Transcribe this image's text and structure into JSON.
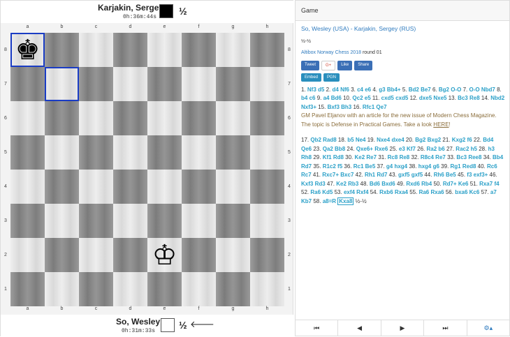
{
  "players": {
    "black": {
      "name": "Karjakin, Sergey",
      "clock": "0h:36m:44s",
      "result": "½"
    },
    "white": {
      "name": "So, Wesley",
      "clock": "0h:31m:33s",
      "result": "½",
      "to_move_arrow": "🡐"
    }
  },
  "board": {
    "files": [
      "a",
      "b",
      "c",
      "d",
      "e",
      "f",
      "g",
      "h"
    ],
    "ranks": [
      "8",
      "7",
      "6",
      "5",
      "4",
      "3",
      "2",
      "1"
    ],
    "pieces": [
      {
        "square": "a8",
        "piece": "black-king",
        "glyph": "♚"
      },
      {
        "square": "e2",
        "piece": "white-king",
        "glyph": "♔"
      }
    ],
    "highlighted": [
      "a8",
      "b7"
    ]
  },
  "panel": {
    "header": "Game",
    "title": "So, Wesley (USA) - Karjakin, Sergey (RUS)",
    "result": "½-½",
    "event_link": "Altibox Norway Chess 2018",
    "round": "round 01",
    "share": {
      "tweet": "Tweet",
      "gplus": "G+",
      "like": "Like",
      "share": "Share",
      "embed": "Embed",
      "pgn": "PGN"
    },
    "moves1": "1. Nf3 d5 2. d4 Nf6 3. c4 e6 4. g3 Bb4+ 5. Bd2 Be7 6. Bg2 O-O 7. O-O Nbd7 8. b4 c6 9. a4 Bd6 10. Qc2 e5 11. cxd5 cxd5 12. dxe5 Nxe5 13. Bc3 Re8 14. Nbd2 Nxf3+ 15. Bxf3 Bh3 16. Rfc1 Qe7",
    "comment_text": "GM Pavel Eljanov with an article for the new issue of Modern Chess Magazine. The topic is Defense in Practical Games. Take a look",
    "comment_link": "HERE",
    "comment_end": "!",
    "moves2": "17. Qb2 Rad8 18. b5 Ne4 19. Nxe4 dxe4 20. Bg2 Bxg2 21. Kxg2 f6 22. Bd4 Qe6 23. Qa2 Bb8 24. Qxe6+ Rxe6 25. e3 Kf7 26. Ra2 b6 27. Rac2 h5 28. h3 Rh8 29. Kf1 Rd8 30. Ke2 Re7 31. Rc8 Re8 32. R8c4 Re7 33. Bc3 Ree8 34. Bb4 Rd7 35. R1c2 f5 36. Rc1 Be5 37. g4 hxg4 38. hxg4 g6 39. Rg1 Red8 40. Rc6 Rc7 41. Rxc7+ Bxc7 42. Rh1 Rd7 43. gxf5 gxf5 44. Rh6 Be5 45. f3 exf3+ 46. Kxf3 Rd3 47. Ke2 Rb3 48. Bd6 Bxd6 49. Rxd6 Rb4 50. Rd7+ Ke6 51. Rxa7 f4 52. Ra6 Kd5 53. exf4 Rxf4 54. Rxb6 Rxa4 55. Ra6 Rxa6 56. bxa6 Kc6 57. a7 Kb7 58. a8=R",
    "current_move": "Kxa8",
    "final_result": "½-½",
    "nav": [
      "⏮",
      "◀",
      "▶",
      "⏭",
      "⚙▴"
    ]
  }
}
